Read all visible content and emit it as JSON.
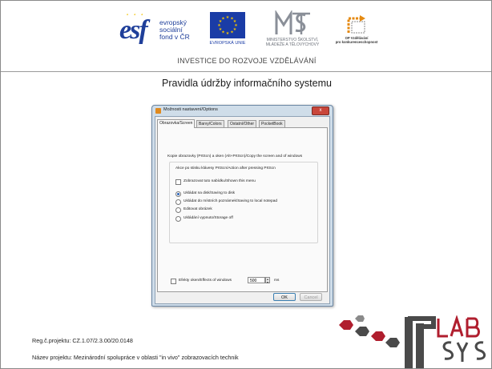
{
  "logos": {
    "esf": {
      "mark": "esf",
      "line1": "evropský",
      "line2": "sociální",
      "line3": "fond v ČR"
    },
    "eu": {
      "caption": "EVROPSKÁ UNIE"
    },
    "msmt": {
      "caption_line1": "MINISTERSTVO ŠKOLSTVÍ,",
      "caption_line2": "MLÁDEŽE A TĚLOVÝCHOVY"
    },
    "op": {
      "caption_line1": "OP Vzdělávání",
      "caption_line2": "pro konkurenceschopnost"
    },
    "tagline": "INVESTICE DO ROZVOJE VZDĚLÁVÁNÍ"
  },
  "slide_title": "Pravidla údržby informačního systemu",
  "dialog": {
    "title": "Možnosti nastavení/Options",
    "close_glyph": "x",
    "tabs": [
      "Obrazovka/Screen",
      "Barvy/Colors",
      "Ostatní/Other",
      "PocketBook"
    ],
    "active_tab": 0,
    "copy_label": "Kopie obrazovky (PrtScn) a oken (Alt+PrtScn)/Copy the screen and of windows",
    "action_label": "Akce po stisku klávesy PrtScn/Action after pressing PrtScn",
    "show_menu_label": "Zobrazovat tuto nabídku/Shown this menu",
    "options": [
      {
        "label": "Ukládat na disk/Saving to disk",
        "selected": true
      },
      {
        "label": "Ukládat do místních poznámek/Saving to local notepad",
        "selected": false
      },
      {
        "label": "Editovat obrázek",
        "selected": false
      },
      {
        "label": "Ukládání vypnuto/Storage off",
        "selected": false
      }
    ],
    "effects_label": "Efekty oken/Effects of windows",
    "effects_value": "500",
    "effects_unit": "ms",
    "ok_label": "OK",
    "cancel_label": "Cancel"
  },
  "footer": {
    "reg": "Reg.č.projektu: CZ.1.07/2.3.00/20.0148",
    "name": "Název projektu: Mezinárodní spolupráce v oblasti \"in vivo\" zobrazovacích technik"
  },
  "colors": {
    "esf_blue": "#1f3f9a",
    "eu_blue": "#1a3ca6",
    "eu_gold": "#f2c200",
    "labsys_red": "#b01e2e",
    "labsys_grey": "#4a4a4a"
  }
}
